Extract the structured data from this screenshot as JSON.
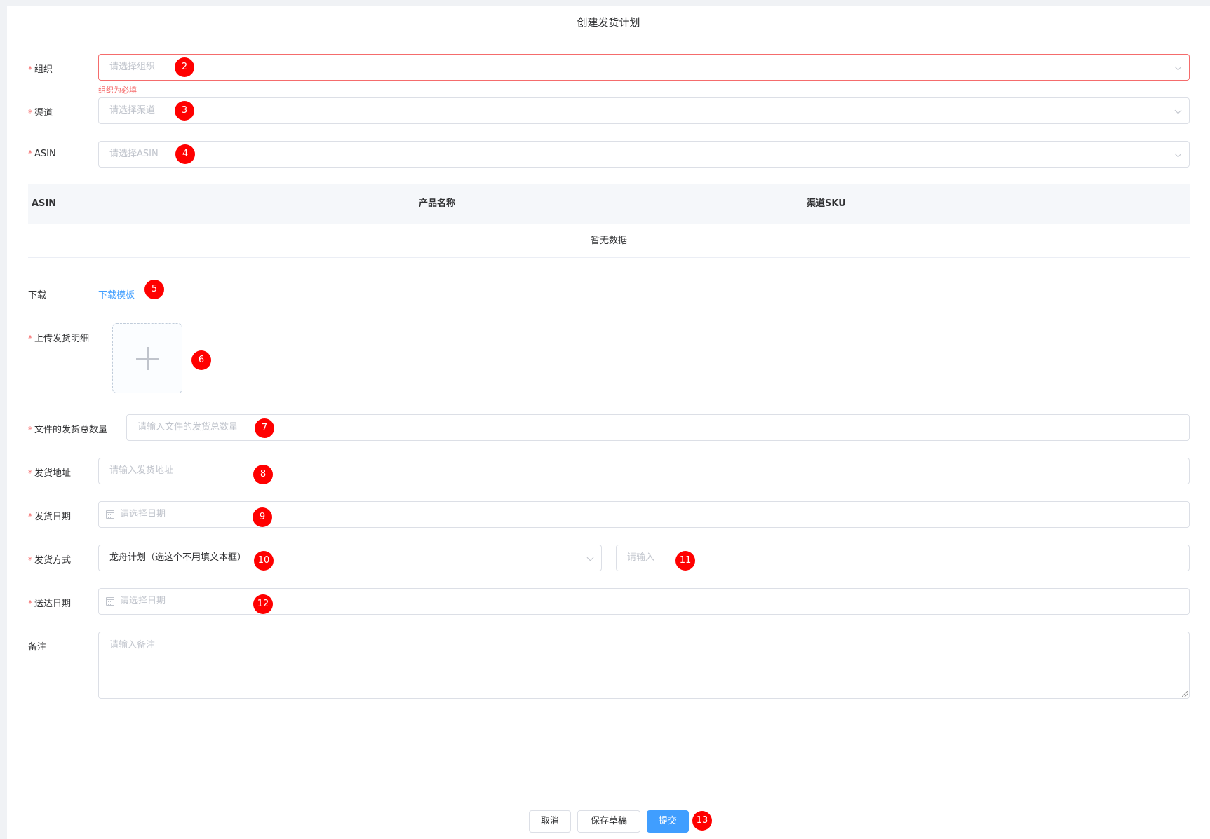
{
  "dialog": {
    "title": "创建发货计划"
  },
  "required_mark": "*",
  "org": {
    "label": "组织",
    "placeholder": "请选择组织",
    "error": "组织为必填"
  },
  "channel": {
    "label": "渠道",
    "placeholder": "请选择渠道"
  },
  "asin": {
    "label": "ASIN",
    "placeholder": "请选择ASIN"
  },
  "table": {
    "columns": [
      "ASIN",
      "产品名称",
      "渠道SKU"
    ],
    "empty_text": "暂无数据"
  },
  "download": {
    "label": "下载",
    "link": "下载模板"
  },
  "upload": {
    "label": "上传发货明细"
  },
  "total_qty": {
    "label": "文件的发货总数量",
    "placeholder": "请输入文件的发货总数量"
  },
  "ship_address": {
    "label": "发货地址",
    "placeholder": "请输入发货地址"
  },
  "ship_date": {
    "label": "发货日期",
    "placeholder": "请选择日期"
  },
  "ship_method": {
    "label": "发货方式",
    "value": "龙舟计划（选这个不用填文本框）",
    "input_placeholder": "请输入"
  },
  "delivery_date": {
    "label": "送达日期",
    "placeholder": "请选择日期"
  },
  "remark": {
    "label": "备注",
    "placeholder": "请输入备注"
  },
  "footer": {
    "cancel": "取消",
    "save_draft": "保存草稿",
    "submit": "提交"
  },
  "badges": [
    "2",
    "3",
    "4",
    "5",
    "6",
    "7",
    "8",
    "9",
    "10",
    "11",
    "12",
    "13"
  ]
}
